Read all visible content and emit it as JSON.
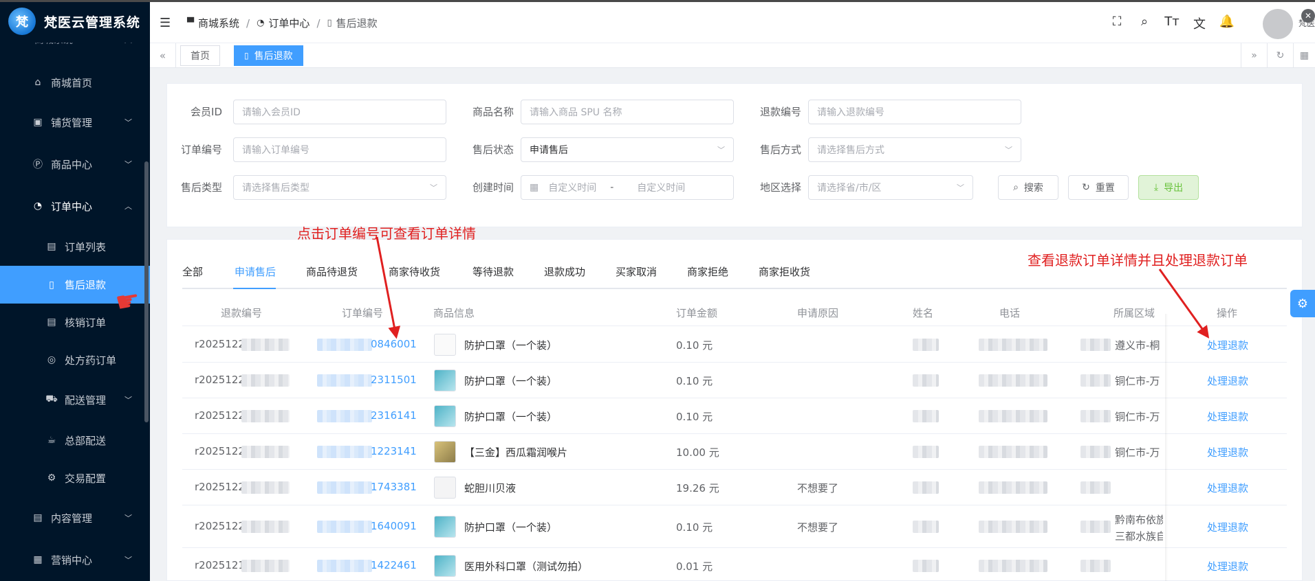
{
  "app": {
    "title": "梵医云管理系统",
    "logo_text": "梵"
  },
  "sidebar": {
    "parent_label": "商城系统",
    "items": [
      {
        "label": "商城首页",
        "icon": "home-icon",
        "glyph": "⌂"
      },
      {
        "label": "铺货管理",
        "icon": "briefcase-icon",
        "glyph": "▣",
        "arrow": "﹀"
      },
      {
        "label": "商品中心",
        "icon": "p-circle-icon",
        "glyph": "Ⓟ",
        "arrow": "﹀"
      },
      {
        "label": "订单中心",
        "icon": "order-icon",
        "glyph": "◔",
        "arrow": "︿"
      },
      {
        "label": "订单列表",
        "icon": "clipboard-icon",
        "glyph": "▤"
      },
      {
        "label": "售后退款",
        "icon": "receipt-icon",
        "glyph": "▯"
      },
      {
        "label": "核销订单",
        "icon": "clipboard-check-icon",
        "glyph": "▤"
      },
      {
        "label": "处方药订单",
        "icon": "basketball-icon",
        "glyph": "◎"
      },
      {
        "label": "配送管理",
        "icon": "cart-icon",
        "glyph": "⛟",
        "arrow": "﹀"
      },
      {
        "label": "总部配送",
        "icon": "coffee-cup-icon",
        "glyph": "☕"
      },
      {
        "label": "交易配置",
        "icon": "settings-icon",
        "glyph": "⚙"
      },
      {
        "label": "内容管理",
        "icon": "document-icon",
        "glyph": "▤",
        "arrow": "﹀"
      },
      {
        "label": "营销中心",
        "icon": "gift-icon",
        "glyph": "▦",
        "arrow": "﹀"
      }
    ]
  },
  "header": {
    "hamburger": "☰",
    "breadcrumb": [
      {
        "label": "商城系统",
        "glyph": "▀"
      },
      {
        "label": "订单中心",
        "glyph": "◔"
      },
      {
        "label": "售后退款",
        "glyph": "▯"
      }
    ],
    "separator": "/",
    "icons": [
      {
        "name": "fullscreen-icon",
        "glyph": "⛶"
      },
      {
        "name": "search-icon",
        "glyph": "⌕"
      },
      {
        "name": "font-size-icon",
        "glyph": "Tт"
      },
      {
        "name": "translate-icon",
        "glyph": "文"
      },
      {
        "name": "bell-icon",
        "glyph": "🔔"
      }
    ],
    "avatar_label": "梵医",
    "close_glyph": "✕"
  },
  "tags": {
    "left_glyph": "«",
    "items": [
      {
        "label": "首页"
      },
      {
        "label": "售后退款",
        "glyph": "▯"
      }
    ],
    "right_glyphs": [
      "»",
      "↻",
      "▦"
    ]
  },
  "filters": {
    "fields": [
      {
        "label": "会员ID",
        "placeholder": "请输入会员ID"
      },
      {
        "label": "商品名称",
        "placeholder": "请输入商品 SPU 名称"
      },
      {
        "label": "退款编号",
        "placeholder": "请输入退款编号"
      },
      {
        "label": "订单编号",
        "placeholder": "请输入订单编号"
      },
      {
        "label": "售后状态",
        "value": "申请售后"
      },
      {
        "label": "售后方式",
        "placeholder": "请选择售后方式"
      },
      {
        "label": "售后类型",
        "placeholder": "请选择售后类型"
      },
      {
        "label": "创建时间",
        "start_placeholder": "自定义时间",
        "end_placeholder": "自定义时间",
        "range_sep": "-"
      },
      {
        "label": "地区选择",
        "placeholder": "请选择省/市/区"
      }
    ],
    "buttons": {
      "search": "搜索",
      "reset": "重置",
      "export": "导出"
    }
  },
  "tabs": [
    "全部",
    "申请售后",
    "商品待退货",
    "商家待收货",
    "等待退款",
    "退款成功",
    "买家取消",
    "商家拒绝",
    "商家拒收货"
  ],
  "table": {
    "columns": [
      "退款编号",
      "订单编号",
      "商品信息",
      "订单金额",
      "申请原因",
      "姓名",
      "电话",
      "所属区域",
      "操作"
    ],
    "rows": [
      {
        "refund_no": "r2025122",
        "order_no": "0846001",
        "product": "防护口罩（一个装）",
        "amount": "0.10 元",
        "reason": "",
        "region": "遵义市-桐",
        "action": "处理退款"
      },
      {
        "refund_no": "r2025122",
        "order_no": "2311501",
        "product": "防护口罩（一个装）",
        "amount": "0.10 元",
        "reason": "",
        "region": "铜仁市-万",
        "action": "处理退款"
      },
      {
        "refund_no": "r2025122",
        "order_no": "2316141",
        "product": "防护口罩（一个装）",
        "amount": "0.10 元",
        "reason": "",
        "region": "铜仁市-万",
        "action": "处理退款"
      },
      {
        "refund_no": "r2025122",
        "order_no": "1223141",
        "product": "【三金】西瓜霜润喉片",
        "amount": "10.00 元",
        "reason": "",
        "region": "铜仁市-万",
        "action": "处理退款"
      },
      {
        "refund_no": "r2025122",
        "order_no": "1743381",
        "product": "蛇胆川贝液",
        "amount": "19.26 元",
        "reason": "不想要了",
        "region": "",
        "action": "处理退款"
      },
      {
        "refund_no": "r2025122",
        "order_no": "1640091",
        "product": "防护口罩（一个装）",
        "amount": "0.10 元",
        "reason": "不想要了",
        "region": "黔南布依族",
        "region2": "三都水族自",
        "action": "处理退款"
      },
      {
        "refund_no": "r2025121",
        "order_no": "1422461",
        "product": "医用外科口罩（测试勿拍）",
        "amount": "0.01 元",
        "reason": "",
        "region": "",
        "action": "处理退款"
      }
    ]
  },
  "annotations": {
    "order_hint": "点击订单编号可查看订单详情",
    "refund_hint": "查看退款订单详情并且处理退款订单",
    "color": "#e02020"
  },
  "colors": {
    "primary": "#409eff",
    "sidebar_bg": "#001529",
    "export_green": "#67c23a"
  }
}
